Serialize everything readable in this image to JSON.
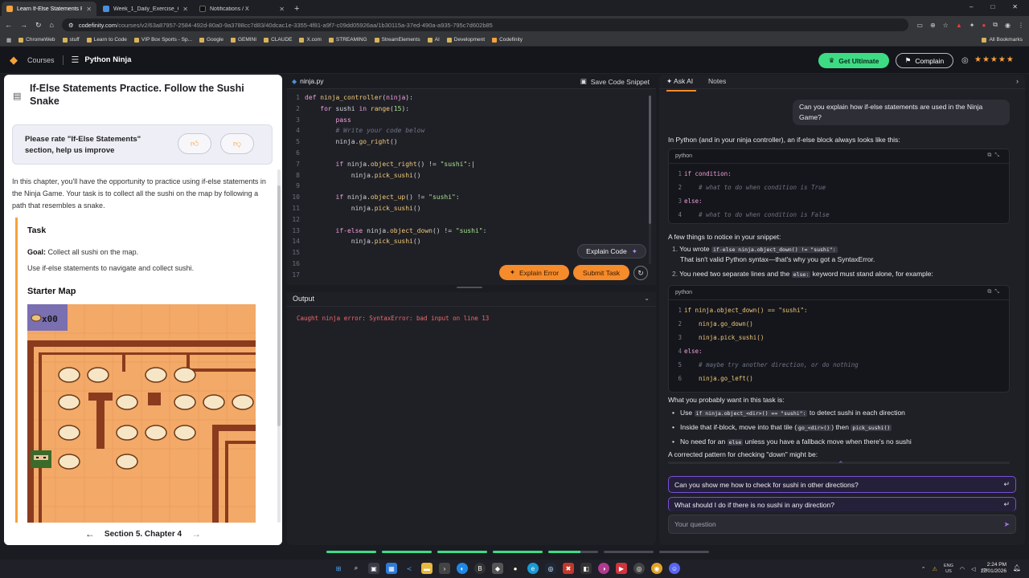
{
  "browser": {
    "tabs": [
      {
        "title": "Learn If-Else Statements Practic",
        "color": "#f6a23b",
        "active": true
      },
      {
        "title": "Week_1_Daily_Exercise_Guide.d",
        "color": "#4c8ed9",
        "active": false
      },
      {
        "title": "Notifications / X",
        "color": "#111111",
        "active": false
      }
    ],
    "new_tab": "+",
    "window_controls": [
      "–",
      "□",
      "✕"
    ],
    "url_host": "codefinity.com",
    "url_path": "/courses/v2/63a87957-2584-492d-80a0-9a3788cc7d83/40dcac1e-3355-4f81-a9f7-c09dd05926aa/1b30115a-37ed-490a-a935-795c7d602b85",
    "bookmarks": [
      "ChromeWeb",
      "stuff",
      "Learn to Code",
      "VIP Box Sports - Sp...",
      "Google",
      "GEMINI",
      "CLAUDE",
      "X.com",
      "STREAMING",
      "StreamElements",
      "AI",
      "Development",
      "Codefinity"
    ],
    "all_bookmarks": "All Bookmarks"
  },
  "header": {
    "courses": "Courses",
    "course_name": "Python Ninja",
    "get_ultimate": "Get Ultimate",
    "complain": "Complain",
    "stars": "★★★★★"
  },
  "lesson": {
    "title": "If-Else Statements Practice. Follow the Sushi Snake",
    "rate_prompt": "Please rate \"If-Else Statements\" section, help us improve",
    "intro": "In this chapter, you'll have the opportunity to practice using if-else statements in the Ninja Game. Your task is to collect all the sushi on the map by following a path that resembles a snake.",
    "task_heading": "Task",
    "goal_label": "Goal:",
    "goal_text": "Collect all sushi on the map.",
    "use_text": "Use if-else statements to navigate and collect sushi.",
    "starter_map": "Starter Map",
    "map_counter": "x00",
    "footer": "Section 5. Chapter 4"
  },
  "editor": {
    "file": "ninja.py",
    "save_code": "Save Code Snippet",
    "explain_code": "Explain Code",
    "explain_error": "Explain Error",
    "submit_task": "Submit Task",
    "line_numbers": [
      "1",
      "2",
      "3",
      "4",
      "5",
      "6",
      "7",
      "8",
      "9",
      "10",
      "11",
      "12",
      "13",
      "14",
      "15",
      "16",
      "17"
    ]
  },
  "output": {
    "title": "Output",
    "message": "Caught ninja error: SyntaxError: bad input on line 13"
  },
  "ai": {
    "tab_ask": "Ask AI",
    "tab_notes": "Notes",
    "user_question": "Can you explain how if-else statements are used in the Ninja Game?",
    "p1": "In Python (and in your ninja controller), an if-else block always looks like this:",
    "code_lang": "python",
    "cb1": [
      "if condition:",
      "    # what to do when condition is True",
      "else:",
      "    # what to do when condition is False"
    ],
    "p2": "A few things to notice in your snippet:",
    "item1_a": "You wrote",
    "item1_code": "if-else ninja.object_down() != \"sushi\":",
    "item1_b": "That isn't valid Python syntax—that's why you got a SyntaxError.",
    "item2_a": "You need two separate lines and the",
    "item2_code": "else:",
    "item2_b": "keyword must stand alone, for example:",
    "cb2": [
      "if ninja.object_down() == \"sushi\":",
      "    ninja.go_down()",
      "    ninja.pick_sushi()",
      "else:",
      "    # maybe try another direction, or do nothing",
      "    ninja.go_left()"
    ],
    "p3": "What you probably want in this task is:",
    "b1_a": "Use",
    "b1_code": "if ninja.object_<dir>() == \"sushi\":",
    "b1_b": "to detect sushi in each direction",
    "b2_a": "Inside that if-block, move into that tile (",
    "b2_code1": "go_<dir>()",
    "b2_mid": ") then",
    "b2_code2": "pick_sushi()",
    "b3_a": "No need for an",
    "b3_code": "else",
    "b3_b": "unless you have a fallback move when there's no sushi",
    "p4": "A corrected pattern for checking \"down\" might be:",
    "suggestion1": "Can you show me how to check for sushi in other directions?",
    "suggestion2": "What should I do if there is no sushi in any direction?",
    "placeholder": "Your question"
  },
  "progress": [
    1,
    1,
    1,
    1,
    0.65,
    0,
    0
  ],
  "taskbar": {
    "lang1": "ENG",
    "lang2": "US",
    "time": "2:24 PM",
    "date": "12/01/2026"
  },
  "colors": {
    "accent": "#f58b2b",
    "brand_green": "#3ddc84",
    "ai_purple": "#7a4fd8",
    "error_red": "#f0696c"
  }
}
